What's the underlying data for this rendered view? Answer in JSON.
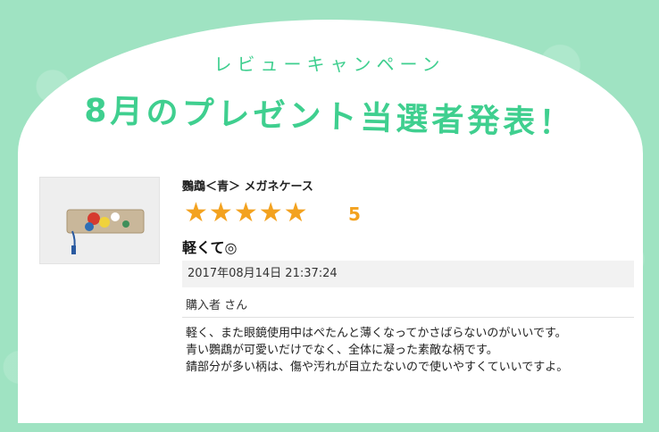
{
  "campaign": {
    "kicker": "レビューキャンペーン",
    "headline": "8月のプレゼント当選者発表！"
  },
  "review": {
    "product_name": "鸚鵡＜青＞ メガネケース",
    "rating": 5,
    "rating_label": "5",
    "title": "軽くて◎",
    "date": "2017年08月14日 21:37:24",
    "reviewer": "購入者 さん",
    "body_lines": [
      "軽く、また眼鏡使用中はぺたんと薄くなってかさばらないのがいいです。",
      "青い鸚鵡が可愛いだけでなく、全体に凝った素敵な柄です。",
      "錆部分が多い柄は、傷や汚れが目立たないので使いやすくていいですよ。"
    ]
  },
  "icons": {
    "star": "star-icon"
  },
  "colors": {
    "accent_green": "#3fcf8f",
    "background_mint": "#9fe3c2",
    "star_orange": "#f3a21f"
  }
}
